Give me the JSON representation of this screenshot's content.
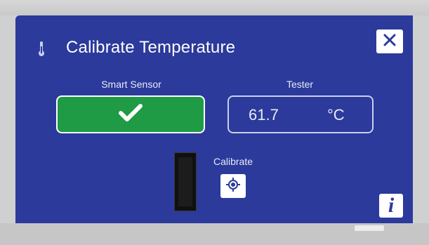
{
  "dialog": {
    "title": "Calibrate Temperature",
    "title_icon": "thermometer-icon",
    "close_icon": "close-icon",
    "bg_color": "#2b3a9b"
  },
  "smart_sensor": {
    "label": "Smart Sensor",
    "status_icon": "checkmark-icon",
    "status_color": "#1f9a45"
  },
  "tester": {
    "label": "Tester",
    "value": "61.7",
    "unit": "°C"
  },
  "calibrate": {
    "label": "Calibrate",
    "icon": "target-icon"
  },
  "info": {
    "icon": "info-icon",
    "glyph": "i"
  }
}
